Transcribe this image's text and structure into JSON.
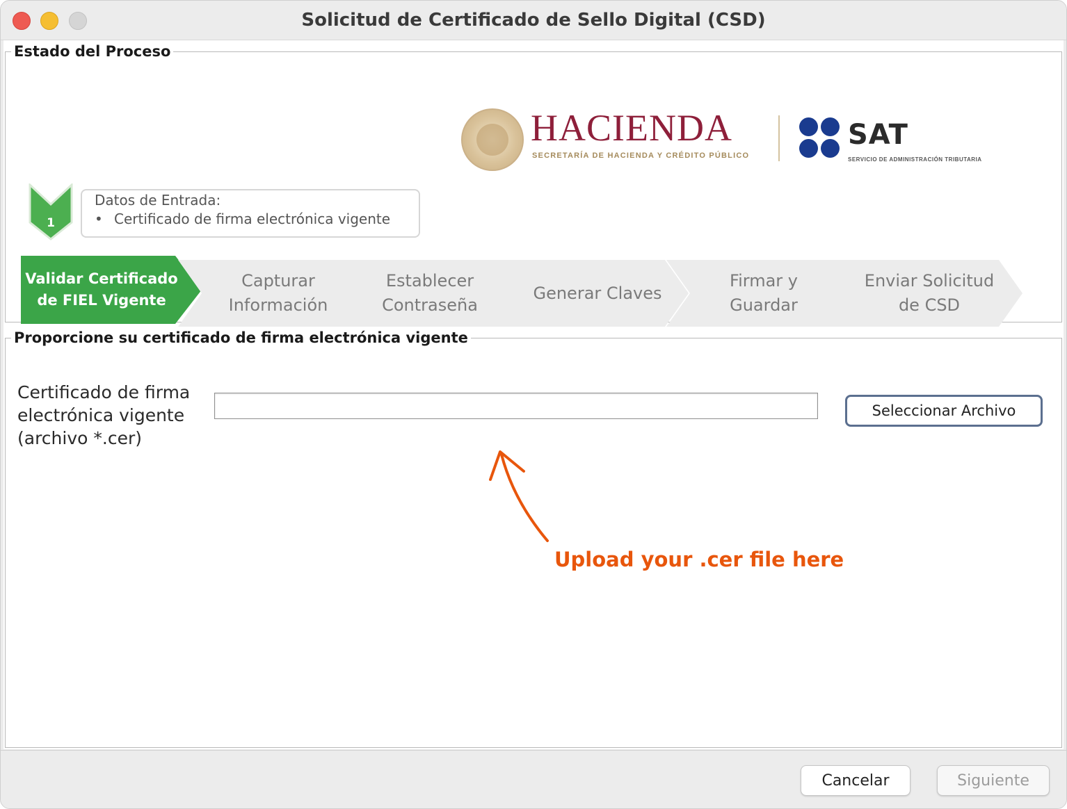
{
  "window": {
    "title": "Solicitud de Certificado de Sello Digital (CSD)"
  },
  "process_group": {
    "legend": "Estado del Proceso",
    "logos": {
      "hacienda": "HACIENDA",
      "hacienda_sub": "SECRETARÍA DE HACIENDA Y CRÉDITO PÚBLICO",
      "sat": "SAT",
      "sat_sub": "SERVICIO DE ADMINISTRACIÓN TRIBUTARIA"
    },
    "step_badge_number": "1",
    "input_box": {
      "label": "Datos de Entrada:",
      "bullet": "•",
      "item": "Certificado de firma electrónica vigente"
    },
    "steps": [
      {
        "label": "Validar Certificado de FIEL Vigente"
      },
      {
        "label": "Capturar Información"
      },
      {
        "label": "Establecer Contraseña"
      },
      {
        "label": "Generar Claves"
      },
      {
        "label": "Firmar y Guardar"
      },
      {
        "label": "Enviar Solicitud de CSD"
      }
    ]
  },
  "certificate_group": {
    "legend": "Proporcione su certificado de firma electrónica vigente",
    "field_label": "Certificado de firma electrónica vigente (archivo *.cer)",
    "file_value": "",
    "select_button": "Seleccionar Archivo",
    "annotation": "Upload your .cer file here"
  },
  "footer": {
    "cancel": "Cancelar",
    "next": "Siguiente"
  },
  "colors": {
    "active_step": "#3ba548",
    "inactive_step": "#ececec",
    "annotation": "#e8560c",
    "hacienda": "#8e1f3a",
    "sat_blue": "#1a3b8f"
  }
}
